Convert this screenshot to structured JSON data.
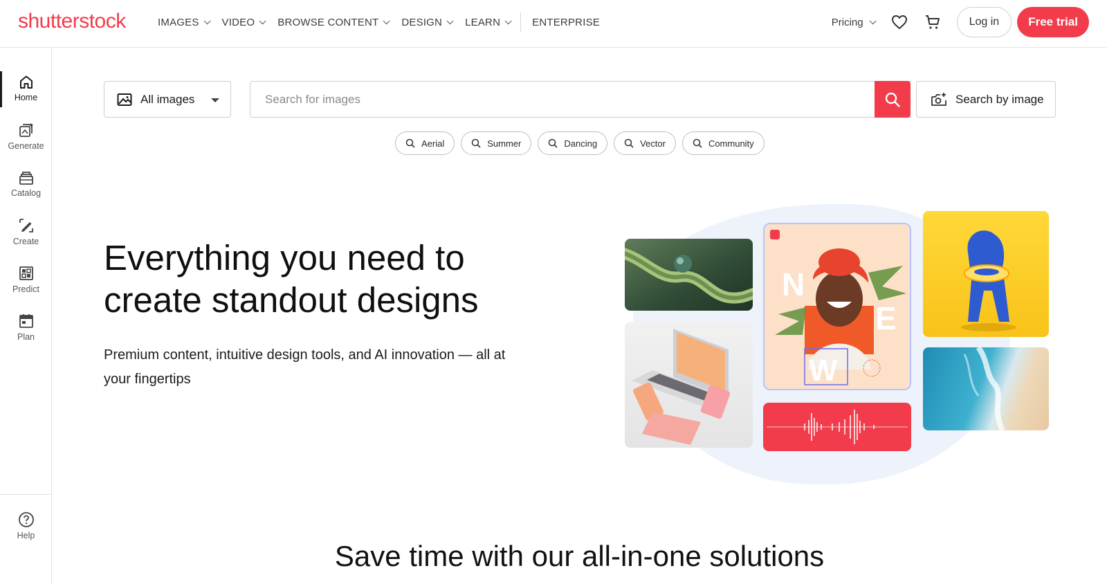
{
  "brand": {
    "logo_text": "shutterstock",
    "accent": "#f23b4b"
  },
  "header": {
    "nav": [
      {
        "label": "IMAGES",
        "has_dropdown": true
      },
      {
        "label": "VIDEO",
        "has_dropdown": true
      },
      {
        "label": "BROWSE CONTENT",
        "has_dropdown": true
      },
      {
        "label": "DESIGN",
        "has_dropdown": true
      },
      {
        "label": "LEARN",
        "has_dropdown": true
      },
      {
        "label": "ENTERPRISE",
        "has_dropdown": false
      }
    ],
    "pricing_label": "Pricing",
    "favorites_icon": "heart-icon",
    "cart_icon": "cart-icon",
    "login_label": "Log in",
    "trial_label": "Free trial"
  },
  "sidebar": {
    "items": [
      {
        "label": "Home",
        "icon": "home-icon",
        "active": true
      },
      {
        "label": "Generate",
        "icon": "generate-icon",
        "active": false
      },
      {
        "label": "Catalog",
        "icon": "catalog-icon",
        "active": false
      },
      {
        "label": "Create",
        "icon": "create-icon",
        "active": false
      },
      {
        "label": "Predict",
        "icon": "predict-icon",
        "active": false
      },
      {
        "label": "Plan",
        "icon": "plan-icon",
        "active": false
      }
    ],
    "help_label": "Help"
  },
  "search": {
    "type_selected": "All images",
    "placeholder": "Search for images",
    "value": "",
    "image_search_label": "Search by image",
    "suggestions": [
      "Aerial",
      "Summer",
      "Dancing",
      "Vector",
      "Community"
    ]
  },
  "hero": {
    "title": "Everything you need to create standout designs",
    "subtitle": "Premium content, intuitive design tools, and AI innovation — all at your fingertips",
    "collage_letters": [
      "N",
      "E",
      "W"
    ]
  },
  "section": {
    "title": "Save time with our all-in-one solutions"
  }
}
